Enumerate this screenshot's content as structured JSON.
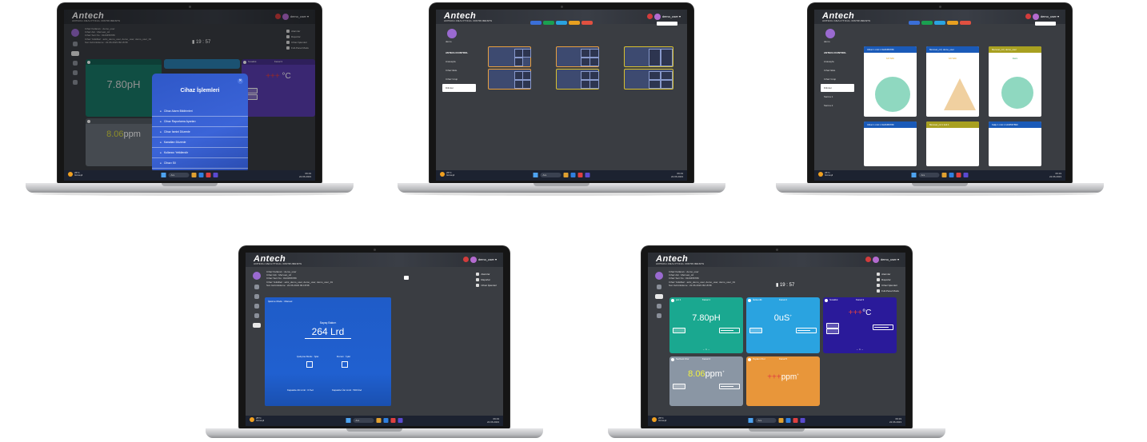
{
  "app": {
    "logo": "Antech",
    "logo_sub": "ANTECH ANALYTICAL INSTRUMENTS",
    "user_name": "demo_user ▾"
  },
  "taskbar": {
    "temp": "25°C",
    "weather": "Güneşli",
    "search": "Ara",
    "time": "09:19",
    "date": "22.06.2023",
    "tray": "^ ☷ ◁) ⚡"
  },
  "device_info": {
    "lines": [
      "Cihaz Kullanıcı : demo_user",
      "Cihaz Adı : Mervuet_cd",
      "Cihaz Seri No : 0123456789",
      "Cihaz Yetkilileri : adni_demo_user, demo_user, demo_user_01",
      "Son Görüntüleme : 22.06.2023 09:18:58"
    ],
    "clock": "19 : 57"
  },
  "right_menu": {
    "items": [
      "Alarmlar",
      "Raporlar",
      "Cihaz İşlemleri",
      "Full-Panel Modu"
    ]
  },
  "screen5_cards": [
    {
      "title": "pH 1",
      "channel": "Kanal 1",
      "value": "7.80",
      "unit": "pH",
      "color": "#1aa890",
      "foot": "← 1 →"
    },
    {
      "title": "İletkenlik",
      "channel": "Kanal 2",
      "value": "0",
      "unit": "uS",
      "color": "#2aa3e0",
      "foot": ""
    },
    {
      "title": "Sıcaklık",
      "channel": "Kanal 3",
      "value": "+++",
      "unit": "°C",
      "color": "#2a1a9a",
      "foot": "← 1 →"
    },
    {
      "title": "Serbest Klor",
      "channel": "Kanal 4",
      "value": "8.06",
      "unit": "ppm",
      "color": "#8a96a4",
      "foot": ""
    },
    {
      "title": "Toplam Klor",
      "channel": "Kanal 5",
      "value": "+++",
      "unit": "ppm",
      "color": "#e8963a",
      "foot": ""
    }
  ],
  "screen1_cards": [
    {
      "value": "7.80",
      "unit": "pH",
      "color": "#1a7868"
    },
    {
      "title": "Sıcaklık",
      "channel": "Kanal 3",
      "value": "+++",
      "unit": "°C",
      "color": "#5a3cb0"
    },
    {
      "value": "8.06",
      "unit": "ppm",
      "color": "#6a727c"
    }
  ],
  "modal": {
    "title": "Cihaz İşlemleri",
    "close": "✕",
    "items": [
      "Cihaz Alarm Bildirimleri",
      "Cihaz Raporlama Ayarları",
      "Cihaz İsmini Düzenle",
      "Kanalları Düzenle",
      "Kullanıcı Yetkilendir",
      "Cihazı Sil"
    ]
  },
  "sidebar2": {
    "user": "demo",
    "title": "ANTECH KONTROL",
    "items": [
      "Anasayfa",
      "Cihaz Ekle",
      "Cihaz Grup",
      "Dilimler",
      "Sarma 1",
      "Sarma 2"
    ]
  },
  "pill_colors": [
    "#3a6fd8",
    "#1aa050",
    "#2aa3e0",
    "#e8a020",
    "#e05040"
  ],
  "screen3_cards": [
    {
      "title": "Cihaz 1 ünit 1 0123456789",
      "color": "#1a5ab8",
      "label": "KAYNAK"
    },
    {
      "title": "Mervuet_cd | demo_user",
      "color": "#1a5ab8",
      "label": "KAYNAK"
    },
    {
      "title": "Mervuet_cd | demo_user",
      "color": "#a8a020",
      "label": "Alarm"
    },
    {
      "title": "Cihaz 1 ünit 1 0123456789",
      "color": "#1a5ab8",
      "label": ""
    },
    {
      "title": "Mervuet_cd 1 ünit 1",
      "color": "#a8a020",
      "label": ""
    },
    {
      "title": "Kalip 1 ünit 1 1234567890",
      "color": "#1a5ab8",
      "label": ""
    }
  ],
  "screen4": {
    "header": "İşletme Modu : Manuel",
    "label_top": "Sayaç Bakım",
    "big_value": "264 Lrd",
    "left_label": "Çalışma Modu : İşlet",
    "right_label": "Durum : İşlet",
    "foot_left": "Kapasite Alt Limit : 0 ℓ/ₕd",
    "foot_right": "Kapasite Üst Limit : 500 ℓ/ₕd"
  }
}
